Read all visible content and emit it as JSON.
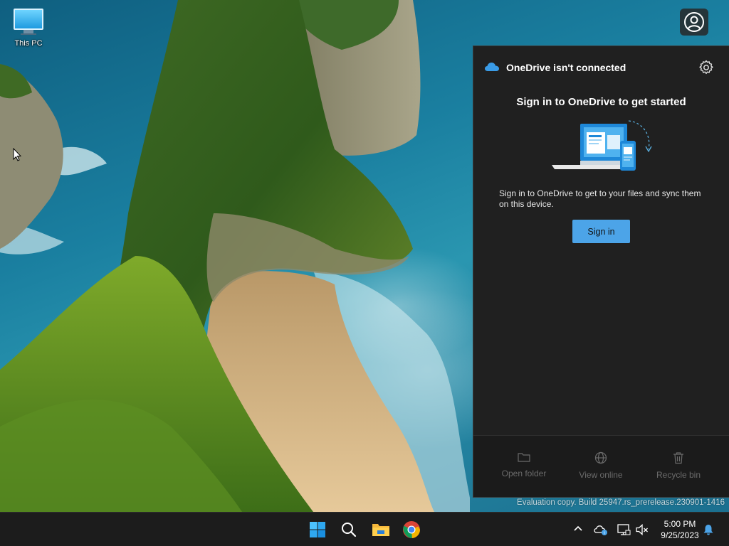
{
  "desktop": {
    "icons": [
      {
        "label": "This PC"
      }
    ],
    "watermark": "Evaluation copy. Build 25947.rs_prerelease.230901-1416"
  },
  "onedrive_flyout": {
    "title": "OneDrive isn't connected",
    "heading": "Sign in to OneDrive to get started",
    "description": "Sign in to OneDrive to get to your files and sync them on this device.",
    "sign_in_button": "Sign in",
    "footer": {
      "open_folder": "Open folder",
      "view_online": "View online",
      "recycle_bin": "Recycle bin"
    },
    "colors": {
      "accent": "#4ca4e8",
      "background": "#202020"
    }
  },
  "taskbar": {
    "apps": [
      {
        "name": "start",
        "icon": "windows-logo-icon"
      },
      {
        "name": "search",
        "icon": "search-icon"
      },
      {
        "name": "file-explorer",
        "icon": "folder-icon"
      },
      {
        "name": "chrome",
        "icon": "chrome-icon"
      }
    ],
    "tray": {
      "icons": [
        "chevron-up-icon",
        "onedrive-icon",
        "network-icon",
        "volume-muted-icon"
      ]
    },
    "clock": {
      "time": "5:00 PM",
      "date": "9/25/2023"
    }
  }
}
